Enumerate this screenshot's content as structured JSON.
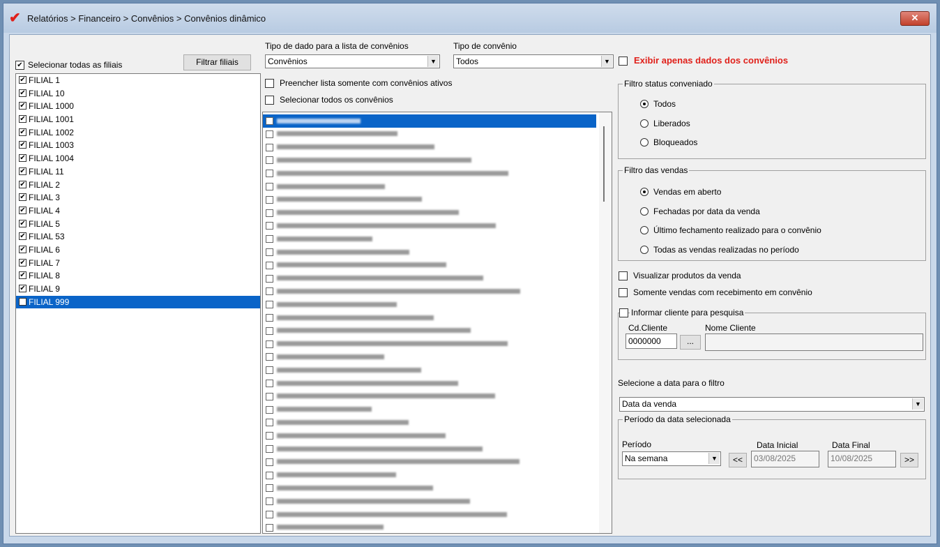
{
  "window": {
    "title": "Relatórios > Financeiro > Convênios > Convênios dinâmico",
    "close_symbol": "✕",
    "app_icon": "red-check-icon"
  },
  "filiais": {
    "select_all_label": "Selecionar todas as filiais",
    "select_all_checked": true,
    "filter_button": "Filtrar filiais",
    "items": [
      {
        "label": "FILIAL 1",
        "checked": true,
        "selected": false
      },
      {
        "label": "FILIAL 10",
        "checked": true,
        "selected": false
      },
      {
        "label": "FILIAL 1000",
        "checked": true,
        "selected": false
      },
      {
        "label": "FILIAL 1001",
        "checked": true,
        "selected": false
      },
      {
        "label": "FILIAL 1002",
        "checked": true,
        "selected": false
      },
      {
        "label": "FILIAL 1003",
        "checked": true,
        "selected": false
      },
      {
        "label": "FILIAL 1004",
        "checked": true,
        "selected": false
      },
      {
        "label": "FILIAL 11",
        "checked": true,
        "selected": false
      },
      {
        "label": "FILIAL 2",
        "checked": true,
        "selected": false
      },
      {
        "label": "FILIAL 3",
        "checked": true,
        "selected": false
      },
      {
        "label": "FILIAL 4",
        "checked": true,
        "selected": false
      },
      {
        "label": "FILIAL 5",
        "checked": true,
        "selected": false
      },
      {
        "label": "FILIAL 53",
        "checked": true,
        "selected": false
      },
      {
        "label": "FILIAL 6",
        "checked": true,
        "selected": false
      },
      {
        "label": "FILIAL 7",
        "checked": true,
        "selected": false
      },
      {
        "label": "FILIAL 8",
        "checked": true,
        "selected": false
      },
      {
        "label": "FILIAL 9",
        "checked": true,
        "selected": false
      },
      {
        "label": "FILIAL 999",
        "checked": true,
        "selected": true
      }
    ]
  },
  "tipo_dado": {
    "label": "Tipo de dado para a lista de convênios",
    "value": "Convênios"
  },
  "tipo_convenio": {
    "label": "Tipo de convênio",
    "value": "Todos"
  },
  "exibir_apenas": {
    "label": "Exibir apenas dados dos convênios",
    "checked": false,
    "color": "#e0201a"
  },
  "convenios": {
    "preencher_ativos_label": "Preencher lista somente com convênios ativos",
    "selecionar_todos_label": "Selecionar todos os convênios",
    "items": [
      {
        "label": "",
        "selected": true
      },
      {
        "label": "",
        "selected": false
      },
      {
        "label": "",
        "selected": false
      },
      {
        "label": "",
        "selected": false
      },
      {
        "label": "",
        "selected": false
      },
      {
        "label": "",
        "selected": false
      },
      {
        "label": "",
        "selected": false
      },
      {
        "label": "",
        "selected": false
      },
      {
        "label": "",
        "selected": false
      },
      {
        "label": "",
        "selected": false
      },
      {
        "label": "",
        "selected": false
      },
      {
        "label": "",
        "selected": false
      },
      {
        "label": "",
        "selected": false
      },
      {
        "label": "",
        "selected": false
      },
      {
        "label": "",
        "selected": false
      },
      {
        "label": "",
        "selected": false
      },
      {
        "label": "",
        "selected": false
      },
      {
        "label": "",
        "selected": false
      },
      {
        "label": "",
        "selected": false
      },
      {
        "label": "",
        "selected": false
      },
      {
        "label": "",
        "selected": false
      },
      {
        "label": "",
        "selected": false
      },
      {
        "label": "",
        "selected": false
      },
      {
        "label": "",
        "selected": false
      },
      {
        "label": "",
        "selected": false
      },
      {
        "label": "",
        "selected": false
      },
      {
        "label": "",
        "selected": false
      },
      {
        "label": "",
        "selected": false
      },
      {
        "label": "",
        "selected": false
      },
      {
        "label": "",
        "selected": false
      },
      {
        "label": "",
        "selected": false
      },
      {
        "label": "",
        "selected": false
      }
    ]
  },
  "filtro_status": {
    "title": "Filtro status conveniado",
    "options": [
      "Todos",
      "Liberados",
      "Bloqueados"
    ],
    "selected": 0
  },
  "filtro_vendas": {
    "title": "Filtro das vendas",
    "options": [
      "Vendas em aberto",
      "Fechadas por data da venda",
      "Último fechamento realizado para o convênio",
      "Todas as vendas realizadas no período"
    ],
    "selected": 0
  },
  "visualizar_produtos": {
    "label": "Visualizar produtos da venda",
    "checked": false
  },
  "somente_recebimento": {
    "label": "Somente vendas com recebimento em convênio",
    "checked": false
  },
  "informar_cliente": {
    "label": "Informar cliente para pesquisa",
    "checked": false,
    "cd_label": "Cd.Cliente",
    "cd_value": "0000000",
    "lookup_button": "...",
    "nome_label": "Nome Cliente",
    "nome_value": ""
  },
  "data_filtro": {
    "label": "Selecione a data para o filtro",
    "value": "Data da venda"
  },
  "periodo_group": {
    "title": "Período da data selecionada",
    "periodo_label": "Período",
    "periodo_value": "Na semana",
    "prev_button": "<<",
    "data_inicial_label": "Data Inicial",
    "data_inicial_value": "03/08/2025",
    "data_final_label": "Data Final",
    "data_final_value": "10/08/2025",
    "next_button": ">>"
  },
  "colors": {
    "selection": "#0a64c8",
    "title_accent": "#e0201a"
  }
}
